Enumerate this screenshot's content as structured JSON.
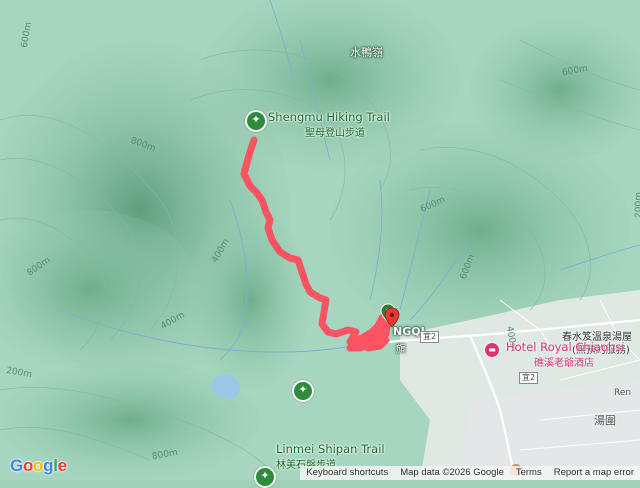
{
  "places": {
    "shengmu_trail": {
      "name": "Shengmu Hiking Trail",
      "sub": "聖母登山步道"
    },
    "linmei_trail": {
      "name": "Linmei Shipan Trail",
      "sub": "林美石磐步道"
    },
    "hotel": {
      "name": "Hotel Royal Chiaohsi",
      "sub": "礁溪老爺酒店"
    },
    "hot_spring": {
      "line1": "春水笈溫泉湯屋",
      "line2": "(無預約服務)"
    },
    "village": {
      "prefix": "",
      "name": "NGQI",
      "zh": "旗"
    },
    "shuiyaling": "水鴨嶺",
    "tangwei": "湯圍"
  },
  "elevation_labels": [
    "600m",
    "800m",
    "600m",
    "400m",
    "800m",
    "400m",
    "600m",
    "200m",
    "400m",
    "200m",
    "600m",
    "800m"
  ],
  "roads": {
    "yi2_a": "宜2",
    "yi2_b": "宜2",
    "ren": "Ren"
  },
  "footer": {
    "shortcuts": "Keyboard shortcuts",
    "map_data": "Map data ©2026 Google",
    "terms": "Terms",
    "report": "Report a map error"
  },
  "logo": "Google",
  "icons": [
    "hiking-icon",
    "map-pin-icon",
    "hotel-icon",
    "bus-stop-icon"
  ],
  "colors": {
    "route": "#ff4d5e",
    "marker_red": "#e53935",
    "marker_green": "#2e7d32",
    "terrain": "#9fd1b8",
    "hotel": "#e3316d"
  }
}
